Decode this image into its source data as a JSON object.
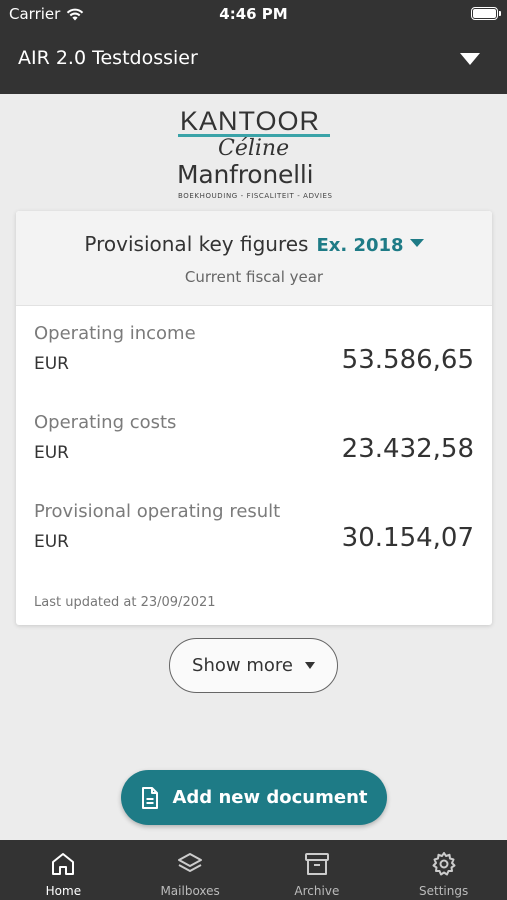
{
  "status_bar": {
    "carrier": "Carrier",
    "time": "4:46 PM"
  },
  "header": {
    "title": "AIR 2.0 Testdossier"
  },
  "logo": {
    "line1": "KANTOOR",
    "line2": "Céline",
    "line3": "Manfronelli",
    "tagline": "BOEKHOUDING - FISCALITEIT - ADVIES"
  },
  "card": {
    "title": "Provisional key figures",
    "year": "Ex. 2018",
    "subtitle": "Current fiscal year",
    "metrics": [
      {
        "label": "Operating income",
        "currency": "EUR",
        "value": "53.586,65"
      },
      {
        "label": "Operating costs",
        "currency": "EUR",
        "value": "23.432,58"
      },
      {
        "label": "Provisional operating result",
        "currency": "EUR",
        "value": "30.154,07"
      }
    ],
    "updated": "Last updated at 23/09/2021"
  },
  "show_more": "Show more",
  "add_document": "Add new document",
  "tabs": [
    {
      "label": "Home",
      "icon": "home-icon",
      "active": true
    },
    {
      "label": "Mailboxes",
      "icon": "layers-icon",
      "active": false
    },
    {
      "label": "Archive",
      "icon": "archive-icon",
      "active": false
    },
    {
      "label": "Settings",
      "icon": "gear-icon",
      "active": false
    }
  ],
  "colors": {
    "accent": "#1e7b86",
    "bar": "#333333",
    "logo_line": "#3aa3a8"
  }
}
